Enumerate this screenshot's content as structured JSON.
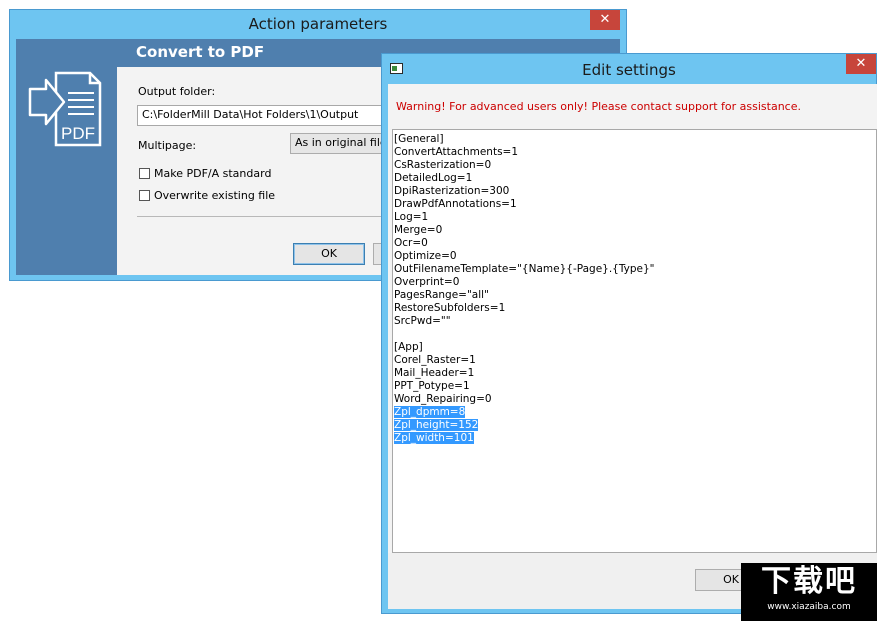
{
  "action_window": {
    "title": "Action parameters",
    "close_glyph": "✕",
    "header": "Convert to PDF",
    "icon_label": "PDF",
    "output_folder_label": "Output folder:",
    "output_folder_value": "C:\\FolderMill Data\\Hot Folders\\1\\Output",
    "multipage_label": "Multipage:",
    "multipage_value": "As in original file",
    "pdfa_label": "Make PDF/A standard",
    "overwrite_label": "Overwrite existing file",
    "ok_label": "OK"
  },
  "edit_window": {
    "title": "Edit settings",
    "close_glyph": "✕",
    "warning": "Warning! For advanced users only! Please contact support for assistance.",
    "lines": [
      "[General]",
      "ConvertAttachments=1",
      "CsRasterization=0",
      "DetailedLog=1",
      "DpiRasterization=300",
      "DrawPdfAnnotations=1",
      "Log=1",
      "Merge=0",
      "Ocr=0",
      "Optimize=0",
      "OutFilenameTemplate=\"{Name}{-Page}.{Type}\"",
      "Overprint=0",
      "PagesRange=\"all\"",
      "RestoreSubfolders=1",
      "SrcPwd=\"\"",
      "",
      "[App]",
      "Corel_Raster=1",
      "Mail_Header=1",
      "PPT_Potype=1",
      "Word_Repairing=0",
      "Zpl_dpmm=8",
      "Zpl_height=152",
      "Zpl_width=101"
    ],
    "selected_lines": [
      21,
      22,
      23
    ],
    "ok_label": "OK"
  },
  "watermark": {
    "big": "下载吧",
    "small": "www.xiazaiba.com"
  }
}
